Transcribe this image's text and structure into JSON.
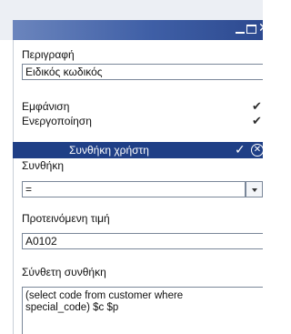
{
  "window": {
    "minimize_icon": "minimize-icon",
    "maximize_icon": "maximize-icon",
    "close_icon": "close-icon",
    "close_glyph": "✕"
  },
  "fields": {
    "description_label": "Περιγραφή",
    "description_value": "Ειδικός κωδικός",
    "visibility_label": "Εμφάνιση",
    "visibility_checked": true,
    "activation_label": "Ενεργοποίηση",
    "activation_checked": true
  },
  "user_condition": {
    "title": "Συνθήκη χρήστη",
    "ok_glyph": "✓",
    "cancel_glyph": "✕",
    "condition_label": "Συνθήκη",
    "condition_value": "=",
    "suggested_value_label": "Προτεινόμενη τιμή",
    "suggested_value": "A0102",
    "composite_label": "Σύνθετη συνθήκη",
    "composite_value": "(select code from customer where\nspecial_code) $c $p"
  },
  "colors": {
    "titlebar": "#3f5fa6",
    "section_header": "#1f3f86"
  }
}
